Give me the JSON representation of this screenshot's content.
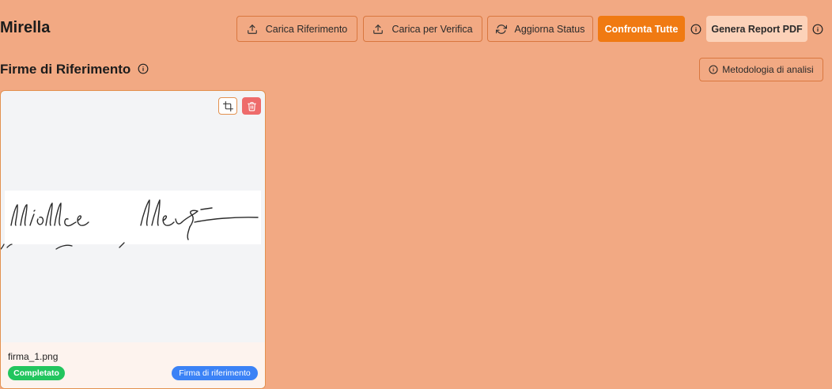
{
  "header": {
    "title": "Mirella",
    "buttons": {
      "upload_reference": "Carica Riferimento",
      "upload_verify": "Carica per Verifica",
      "refresh_status": "Aggiorna Status",
      "compare_all": "Confronta Tutte",
      "generate_pdf": "Genera Report PDF"
    }
  },
  "section": {
    "title": "Firme di Riferimento",
    "methodology_label": "Metodologia di analisi"
  },
  "cards": [
    {
      "filename": "firma_1.png",
      "status_badge": "Completato",
      "type_badge": "Firma di riferimento"
    }
  ],
  "colors": {
    "background": "#f2a983",
    "primary": "#f07a12",
    "border": "#d9773f",
    "success": "#22c55e",
    "info": "#3b82f6",
    "danger": "#ee6b6b"
  },
  "icons": [
    "upload-icon",
    "refresh-icon",
    "info-icon",
    "crop-icon",
    "trash-icon"
  ]
}
